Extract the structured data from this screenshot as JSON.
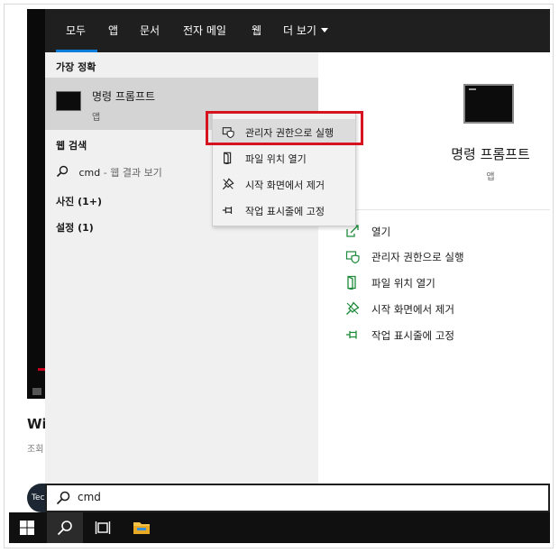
{
  "tabs": [
    {
      "label": "모두"
    },
    {
      "label": "앱"
    },
    {
      "label": "문서"
    },
    {
      "label": "전자 메일"
    },
    {
      "label": "웹"
    },
    {
      "label": "더 보기"
    }
  ],
  "left": {
    "best_match_header": "가장 정확",
    "best_match": {
      "title": "명령 프롬프트",
      "subtitle": "앱"
    },
    "web_header": "웹 검색",
    "web_query": "cmd",
    "web_suffix": " - 웹 결과 보기",
    "photos": "사진 (1+)",
    "settings": "설정 (1)"
  },
  "context_menu": [
    {
      "label": "관리자 권한으로 실행",
      "icon": "shield-icon"
    },
    {
      "label": "파일 위치 열기",
      "icon": "folder-location-icon"
    },
    {
      "label": "시작 화면에서 제거",
      "icon": "unpin-icon"
    },
    {
      "label": "작업 표시줄에 고정",
      "icon": "pin-icon"
    }
  ],
  "right": {
    "title": "명령 프롬프트",
    "subtitle": "앱",
    "actions": [
      {
        "label": "열기",
        "icon": "open-icon"
      },
      {
        "label": "관리자 권한으로 실행",
        "icon": "shield-icon"
      },
      {
        "label": "파일 위치 열기",
        "icon": "folder-location-icon"
      },
      {
        "label": "시작 화면에서 제거",
        "icon": "unpin-icon"
      },
      {
        "label": "작업 표시줄에 고정",
        "icon": "pin-icon"
      }
    ]
  },
  "search": {
    "value": "cmd"
  },
  "background": {
    "title": "Wi",
    "sub": "조회",
    "avatar_text": "Tec"
  },
  "colors": {
    "accent": "#0d7bd8",
    "highlight_box": "#d6141f",
    "topbar": "#1f1f1f",
    "taskbar": "#101010"
  }
}
